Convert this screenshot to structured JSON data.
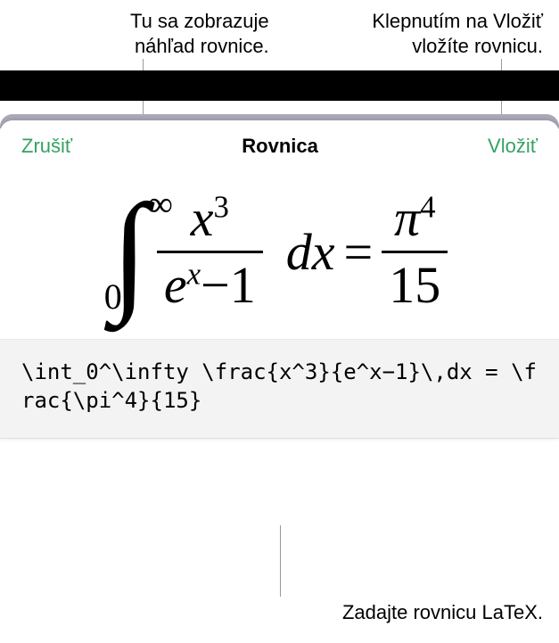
{
  "callouts": {
    "preview_line1": "Tu sa zobrazuje",
    "preview_line2": "náhľad rovnice.",
    "insert_line1": "Klepnutím na Vložiť",
    "insert_line2": "vložíte rovnicu.",
    "latex_hint": "Zadajte rovnicu LaTeX."
  },
  "toolbar": {
    "cancel": "Zrušiť",
    "title": "Rovnica",
    "insert": "Vložiť"
  },
  "equation": {
    "int_sign": "∫",
    "int_lower": "0",
    "int_upper": "∞",
    "frac1_num_base": "x",
    "frac1_num_exp": "3",
    "frac1_den_e": "e",
    "frac1_den_exp": "x",
    "frac1_den_minus": "−",
    "frac1_den_one": "1",
    "dx_d": "d",
    "dx_x": "x",
    "equals": "=",
    "frac2_num_base": "π",
    "frac2_num_exp": "4",
    "frac2_den": "15"
  },
  "latex": {
    "source": "\\int_0^\\infty \\frac{x^3}{e^x−1}\\,dx = \\frac{\\pi^4}{15}"
  }
}
